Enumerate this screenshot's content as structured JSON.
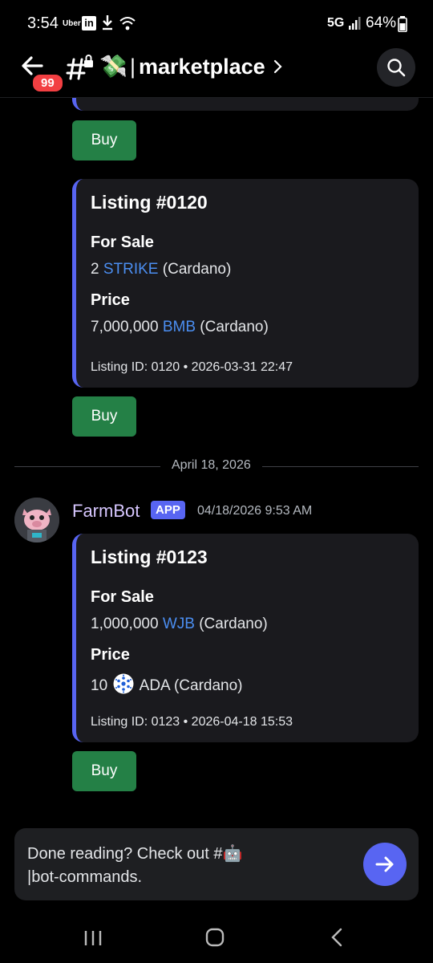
{
  "status": {
    "time": "3:54",
    "uber": "Uber",
    "linkedin": "in",
    "network": "5G",
    "battery": "64%"
  },
  "header": {
    "badge": "99",
    "channel_emoji": "💸",
    "channel_name": "marketplace"
  },
  "messages": {
    "listing_0120": {
      "title": "Listing #0120",
      "for_sale_label": "For Sale",
      "for_sale_amount": "2",
      "for_sale_token": "STRIKE",
      "for_sale_chain": "(Cardano)",
      "price_label": "Price",
      "price_amount": "7,000,000",
      "price_token": "BMB",
      "price_chain": "(Cardano)",
      "footer": "Listing ID: 0120 • 2026-03-31 22:47"
    },
    "date_divider": "April 18, 2026",
    "bot": {
      "name": "FarmBot",
      "tag": "APP",
      "timestamp": "04/18/2026 9:53 AM"
    },
    "listing_0123": {
      "title": "Listing #0123",
      "for_sale_label": "For Sale",
      "for_sale_amount": "1,000,000",
      "for_sale_token": "WJB",
      "for_sale_chain": "(Cardano)",
      "price_label": "Price",
      "price_amount": "10",
      "price_token": "ADA (Cardano)",
      "footer": "Listing ID: 0123 • 2026-04-18 15:53"
    },
    "buy_label": "Buy"
  },
  "composer": {
    "line1": "Done reading? Check out #🤖",
    "line2": "bot-commands."
  },
  "colors": {
    "accent": "#5865f2",
    "buy_green": "#248046",
    "link_blue": "#4b8ef1",
    "badge_red": "#f23f42"
  }
}
